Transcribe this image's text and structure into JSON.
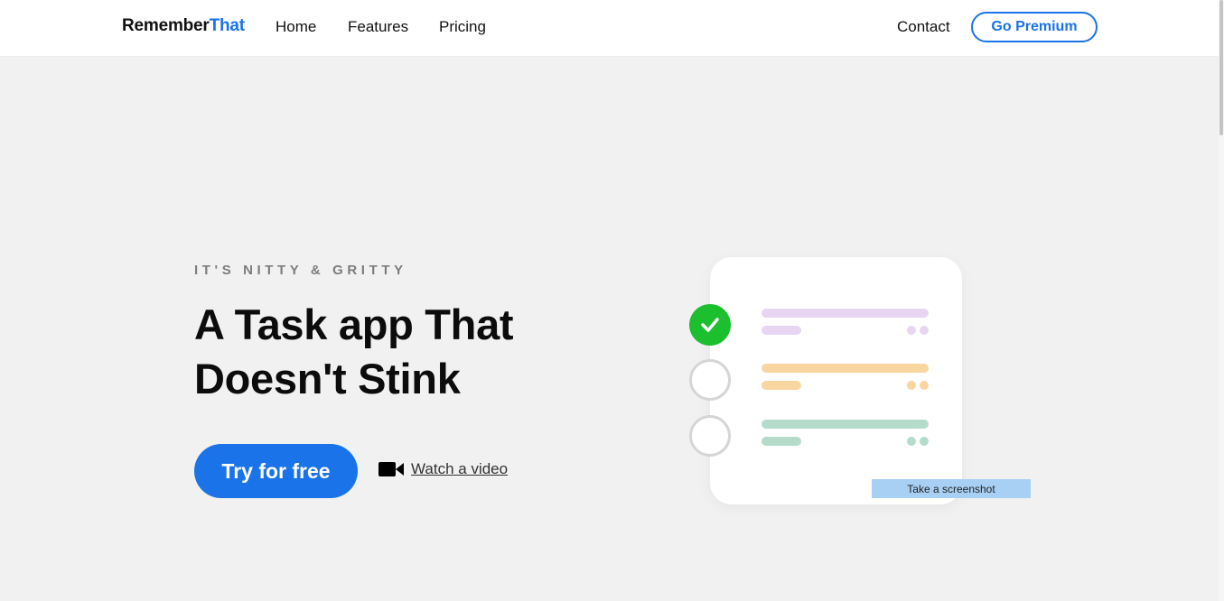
{
  "header": {
    "logo_part1": "Remember",
    "logo_part2": "That",
    "nav": {
      "home": "Home",
      "features": "Features",
      "pricing": "Pricing"
    },
    "contact": "Contact",
    "premium_label": "Go Premium"
  },
  "hero": {
    "eyebrow": "IT'S NITTY & GRITTY",
    "headline_line1": "A Task app That",
    "headline_line2": "Doesn't Stink",
    "cta_label": "Try for free",
    "video_label": "Watch a video",
    "video_icon": "video-camera-icon"
  },
  "illustration": {
    "rows": [
      {
        "done": true,
        "color": "#e8d5f2"
      },
      {
        "done": false,
        "color": "#f9d5a0"
      },
      {
        "done": false,
        "color": "#b5dccb"
      }
    ],
    "check_color": "#1cbf2e"
  },
  "tooltip": "Take a screenshot",
  "colors": {
    "accent": "#1a73e8",
    "background": "#f1f1f1"
  }
}
